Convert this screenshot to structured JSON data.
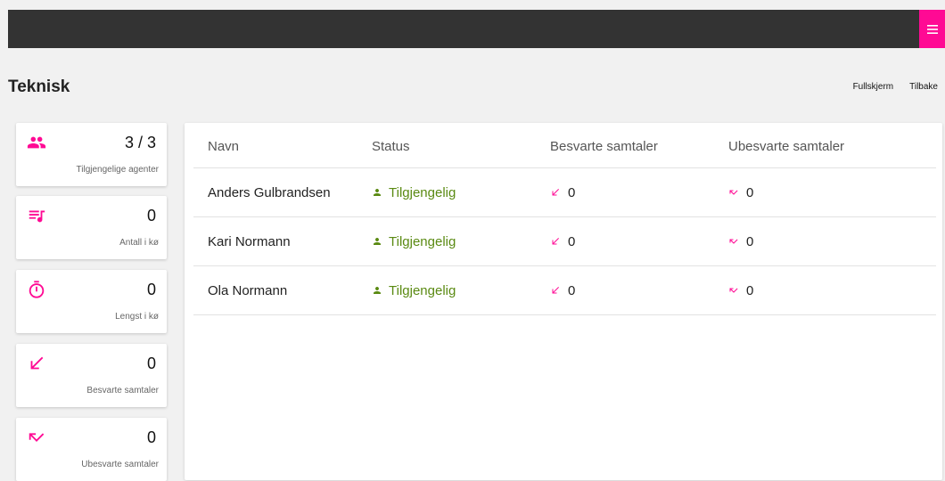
{
  "colors": {
    "topbar": "#333333",
    "accent": "#ff0a94",
    "status_ok": "#5a8a12"
  },
  "header": {
    "menu_icon": "hamburger-icon"
  },
  "page": {
    "title": "Teknisk",
    "links": {
      "fullscreen": "Fullskjerm",
      "back": "Tilbake"
    }
  },
  "stats": [
    {
      "icon": "people-icon",
      "value": "3 / 3",
      "label": "Tilgjengelige agenter"
    },
    {
      "icon": "queue-music-icon",
      "value": "0",
      "label": "Antall i kø"
    },
    {
      "icon": "timer-icon",
      "value": "0",
      "label": "Lengst i kø"
    },
    {
      "icon": "call-received-icon",
      "value": "0",
      "label": "Besvarte samtaler"
    },
    {
      "icon": "call-missed-icon",
      "value": "0",
      "label": "Ubesvarte samtaler"
    }
  ],
  "table": {
    "columns": [
      "Navn",
      "Status",
      "Besvarte samtaler",
      "Ubesvarte samtaler"
    ],
    "rows": [
      {
        "name": "Anders Gulbrandsen",
        "status": "Tilgjengelig",
        "answered": "0",
        "missed": "0"
      },
      {
        "name": "Kari Normann",
        "status": "Tilgjengelig",
        "answered": "0",
        "missed": "0"
      },
      {
        "name": "Ola Normann",
        "status": "Tilgjengelig",
        "answered": "0",
        "missed": "0"
      }
    ]
  }
}
